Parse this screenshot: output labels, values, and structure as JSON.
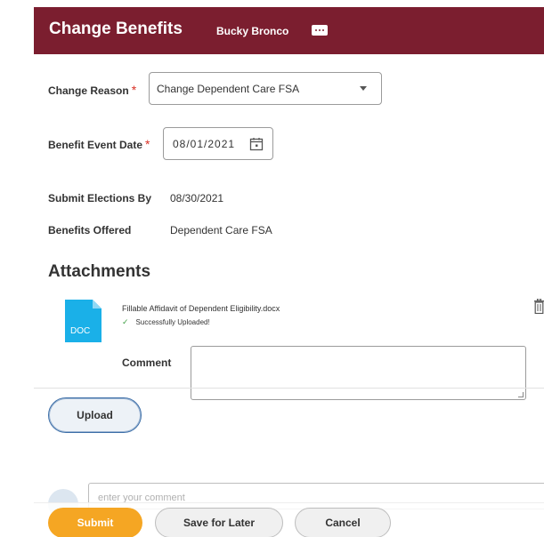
{
  "header": {
    "title": "Change Benefits",
    "worker": "Bucky Bronco",
    "brand_color": "#7b1e2f"
  },
  "form": {
    "change_reason": {
      "label": "Change Reason",
      "required_mark": "*",
      "value": "Change Dependent Care FSA"
    },
    "benefit_event_date": {
      "label": "Benefit Event Date",
      "required_mark": "*",
      "value": "08/01/2021"
    },
    "submit_elections_by": {
      "label": "Submit Elections By",
      "value": "08/30/2021"
    },
    "benefits_offered": {
      "label": "Benefits Offered",
      "value": "Dependent Care FSA"
    }
  },
  "attachments": {
    "heading": "Attachments",
    "file": {
      "icon_text": "DOC",
      "name": "Fillable Affidavit of Dependent Eligibility.docx",
      "status": "Successfully Uploaded!"
    },
    "comment_label": "Comment",
    "comment_value": "",
    "upload_label": "Upload"
  },
  "post_comment": {
    "placeholder": "enter your comment"
  },
  "footer": {
    "submit_label": "Submit",
    "save_label": "Save for Later",
    "cancel_label": "Cancel",
    "submit_color": "#f5a623"
  },
  "icons": [
    "more-icon",
    "chevron-down-icon",
    "calendar-icon",
    "doc-file-icon",
    "check-icon",
    "trash-icon",
    "avatar-icon"
  ]
}
